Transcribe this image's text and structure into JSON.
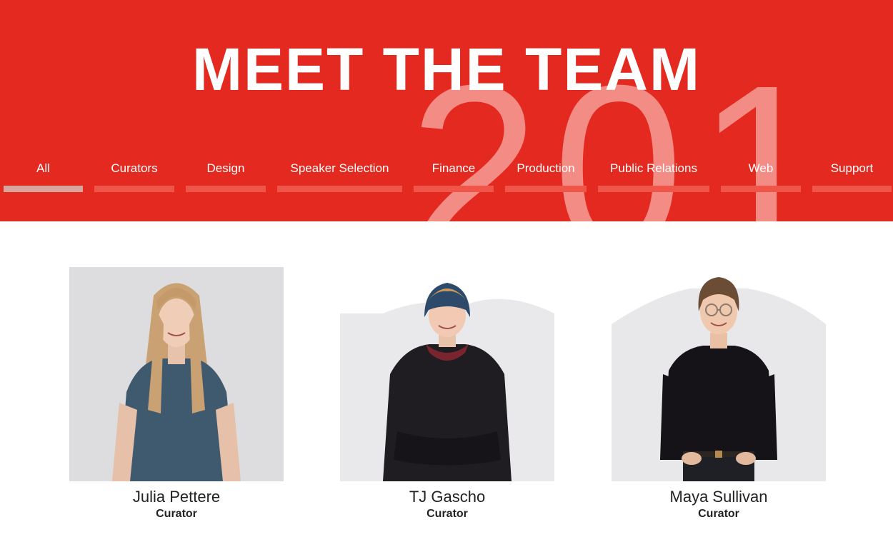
{
  "hero": {
    "title": "MEET THE TEAM",
    "background_year": "201",
    "colors": {
      "background": "#e42a20",
      "year": "#f48c86",
      "tab_bar": "#f0554a",
      "tab_bar_active": "#d8a49e"
    }
  },
  "tabs": [
    {
      "label": "All",
      "active": true
    },
    {
      "label": "Curators",
      "active": false
    },
    {
      "label": "Design",
      "active": false
    },
    {
      "label": "Speaker Selection",
      "active": false
    },
    {
      "label": "Finance",
      "active": false
    },
    {
      "label": "Production",
      "active": false
    },
    {
      "label": "Public Relations",
      "active": false
    },
    {
      "label": "Web",
      "active": false
    },
    {
      "label": "Support",
      "active": false
    }
  ],
  "members": [
    {
      "name": "Julia Pettere",
      "role": "Curator"
    },
    {
      "name": "TJ Gascho",
      "role": "Curator"
    },
    {
      "name": "Maya Sullivan",
      "role": "Curator"
    }
  ]
}
